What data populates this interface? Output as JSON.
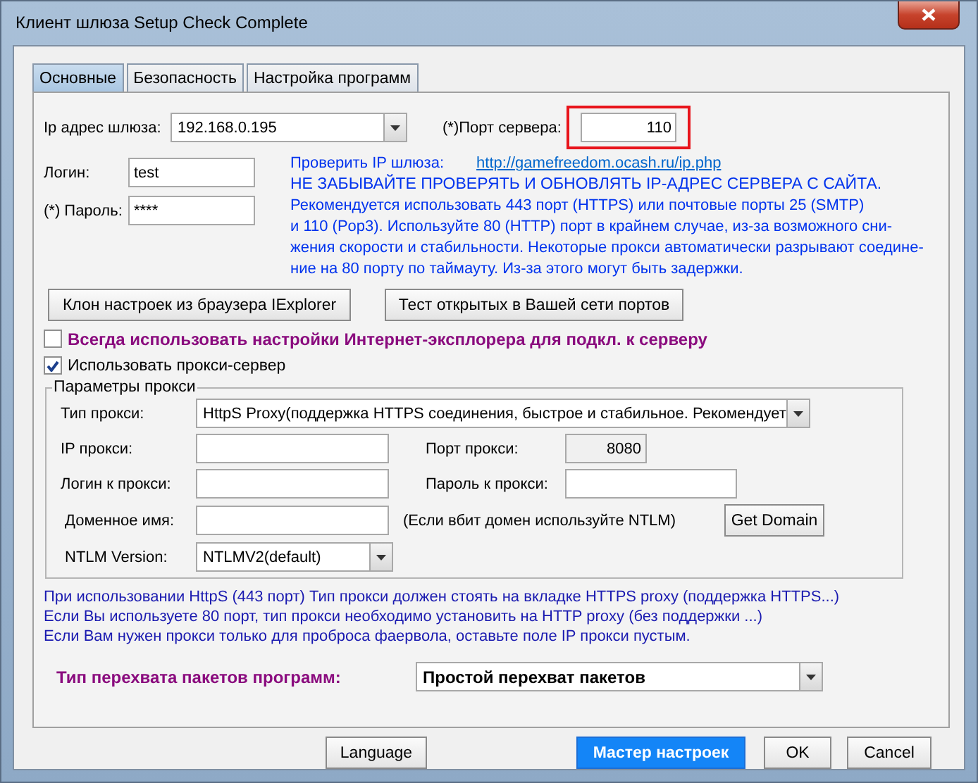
{
  "window": {
    "title": "Клиент шлюза  Setup Check Complete"
  },
  "tabs": [
    {
      "label": "Основные",
      "selected": true
    },
    {
      "label": "Безопасность",
      "selected": false
    },
    {
      "label": "Настройка программ",
      "selected": false
    }
  ],
  "gateway": {
    "ip_label": "Ip адрес шлюза:",
    "ip_value": "192.168.0.195",
    "port_label": "(*)Порт сервера:",
    "port_value": "110",
    "port_highlighted": true,
    "login_label": "Логин:",
    "login_value": "test",
    "password_label": "(*) Пароль:",
    "password_value": "****"
  },
  "check_ip": {
    "label": "Проверить IP шлюза:",
    "link": "http://gamefreedom.ocash.ru/ip.php"
  },
  "notice": {
    "heading": "НЕ ЗАБЫВАЙТЕ ПРОВЕРЯТЬ И ОБНОВЛЯТЬ IP-АДРЕС СЕРВЕРА С САЙТА.",
    "lines": [
      "Рекомендуется использовать 443 порт (HTTPS) или почтовые порты 25 (SMTP)",
      "и 110 (Pop3). Используйте 80 (HTTP) порт в крайнем случае, из-за возможного сни-",
      "жения скорости и стабильности. Некоторые прокси автоматически разрывают соедине-",
      "ние на 80 порту по таймауту. Из-за этого могут быть задержки."
    ]
  },
  "tool_buttons": [
    "Клон настроек из браузера IExplorer",
    "Тест открытых в Вашей сети портов"
  ],
  "checkboxes": [
    {
      "label": "Всегда использовать настройки Интернет-эксплорера для подкл. к серверу",
      "checked": false,
      "kind": "emphasis"
    },
    {
      "label": "Использовать прокси-сервер",
      "checked": true,
      "kind": "plain"
    }
  ],
  "proxy": {
    "title": "Параметры прокси",
    "type_label": "Тип прокси:",
    "type_value": "HttpS Proxy(поддержка HTTPS соединения, быстрое и стабильное. Рекомендует",
    "ip_label": "IP прокси:",
    "port_label": "Порт прокси:",
    "port_value": "8080",
    "login_label": "Логин к прокси:",
    "password_label": "Пароль к прокси:",
    "domain_label": "Доменное имя:",
    "domain_hint": "(Если вбит домен используйте NTLM)",
    "domain_button": "Get Domain",
    "ntlm_label": "NTLM Version:",
    "ntlm_value": "NTLMV2(default)"
  },
  "notes": [
    "При использовании HttpS (443 порт) Тип прокси должен стоять на вкладке HTTPS proxy (поддержка HTTPS...)",
    "Если Вы используете  80 порт, тип прокси необходимо установить на HTTP proxy (без поддержки ...)",
    "Если Вам нужен прокси только для проброса фаервола, оставьте поле IP прокси пустым."
  ],
  "intercept": {
    "label": "Тип перехвата пакетов программ:",
    "value": "Простой перехват пакетов"
  },
  "footer_buttons": [
    {
      "label": "Language",
      "primary": false
    },
    {
      "label": "Мастер настроек",
      "primary": true
    },
    {
      "label": "OK",
      "primary": false
    },
    {
      "label": "Cancel",
      "primary": false
    }
  ]
}
